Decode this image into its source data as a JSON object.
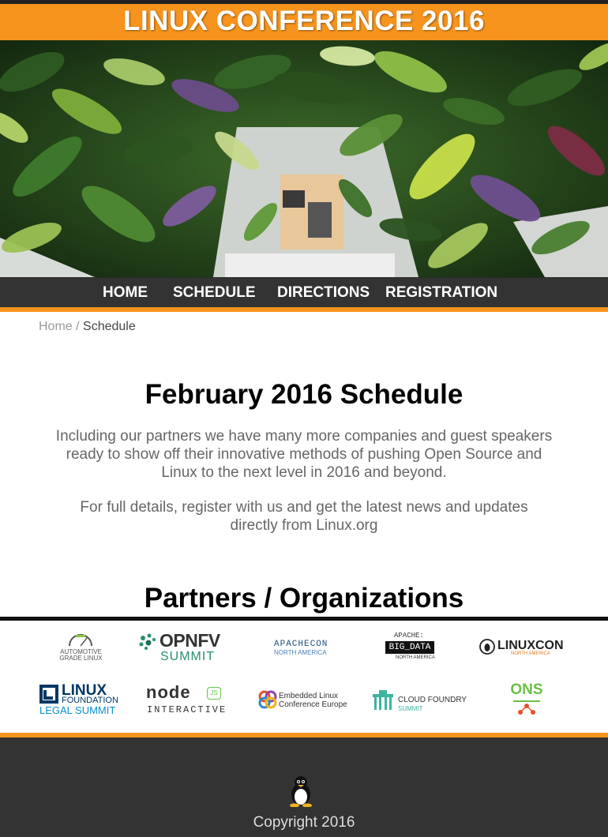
{
  "header": {
    "title": "LINUX CONFERENCE 2016"
  },
  "nav": {
    "items": [
      "HOME",
      "SCHEDULE",
      "DIRECTIONS",
      "REGISTRATION"
    ]
  },
  "breadcrumb": {
    "home": "Home",
    "separator": " / ",
    "current": "Schedule"
  },
  "main": {
    "heading": "February 2016 Schedule",
    "intro": "Including our partners we have many more companies and guest speakers ready to show off their innovative methods of pushing Open Source and Linux to the next level in 2016 and beyond.",
    "details": "For full details, register with us and get the latest news and updates directly from Linux.org"
  },
  "partners": {
    "heading": "Partners / Organizations",
    "logos": {
      "agl_line1": "AUTOMOTIVE",
      "agl_line2": "GRADE LINUX",
      "opnfv_line1": "OPNFV",
      "opnfv_line2": "SUMMIT",
      "apachecon_line1": "APACHECON",
      "apachecon_line2": "NORTH AMERICA",
      "bigdata_line1": "APACHE:",
      "bigdata_line2": "BIG_DATA",
      "bigdata_line3": "NORTH AMERICA",
      "linuxcon_line1": "LINUXCON",
      "linuxcon_line2": "NORTH AMERICA",
      "lf_line1": "LINUX",
      "lf_line2": "FOUNDATION",
      "lf_line3": "LEGAL SUMMIT",
      "node_line1": "node",
      "node_line2": "INTERACTIVE",
      "node_badge": "JS",
      "elce_line1": "Embedded Linux",
      "elce_line2": "Conference Europe",
      "cf_line1": "CLOUD FOUNDRY",
      "cf_line2": "SUMMIT",
      "ons_line1": "ONS"
    }
  },
  "footer": {
    "copyright": "Copyright 2016"
  },
  "colors": {
    "accent": "#f7941d",
    "dark": "#333333"
  }
}
